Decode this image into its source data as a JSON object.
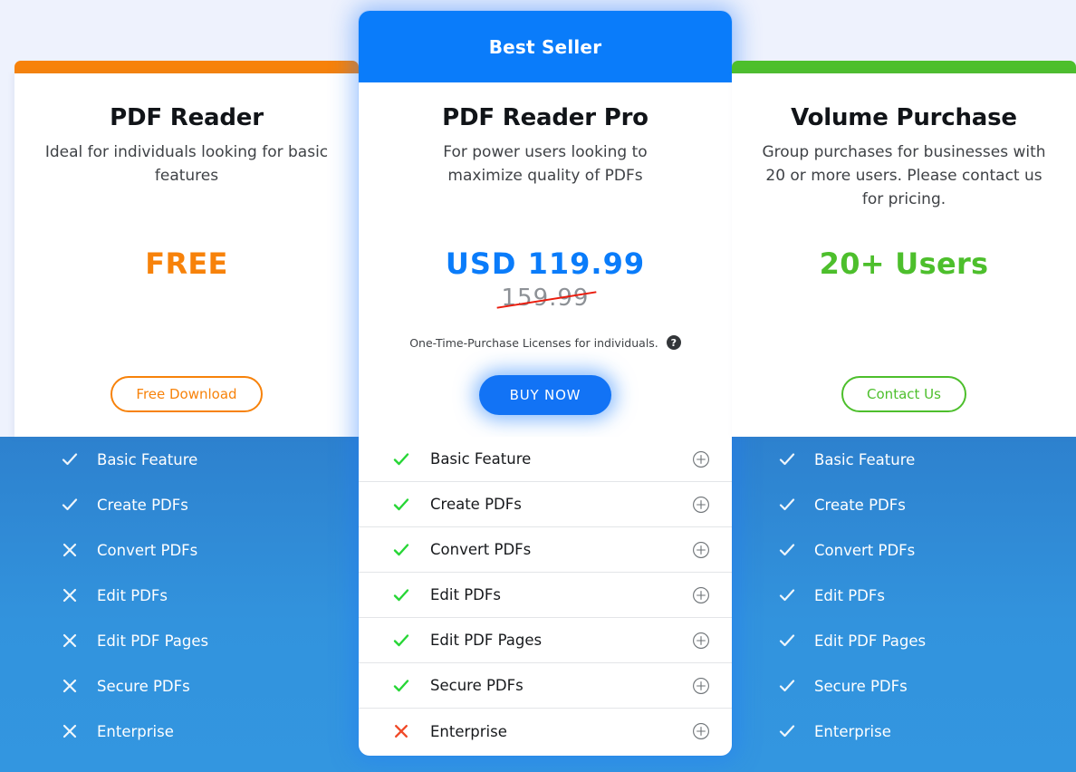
{
  "theme": {
    "page_bg": "#eef2fd",
    "panel_blue": "#3293dd",
    "accent_orange": "#f7820a",
    "accent_blue": "#0a7cfa",
    "accent_green": "#4dbf2c",
    "check_green": "#27d636",
    "cross_red": "#f04a28",
    "strike_red": "#ea1c0d"
  },
  "plans": [
    {
      "id": "pdf-reader",
      "badge": null,
      "title": "PDF Reader",
      "description": "Ideal for individuals looking for basic features",
      "price": "FREE",
      "old_price": null,
      "note": null,
      "cta_label": "Free Download",
      "features": [
        {
          "label": "Basic Feature",
          "mark": "check"
        },
        {
          "label": "Create PDFs",
          "mark": "check"
        },
        {
          "label": "Convert PDFs",
          "mark": "cross"
        },
        {
          "label": "Edit PDFs",
          "mark": "cross"
        },
        {
          "label": "Edit PDF Pages",
          "mark": "cross"
        },
        {
          "label": "Secure PDFs",
          "mark": "cross"
        },
        {
          "label": "Enterprise",
          "mark": "cross"
        }
      ]
    },
    {
      "id": "pdf-reader-pro",
      "badge": "Best Seller",
      "title": "PDF Reader Pro",
      "description": "For power users looking to maximize quality of PDFs",
      "price": "USD 119.99",
      "old_price": "159.99",
      "note": "One-Time-Purchase Licenses for individuals.",
      "note_icon": "help-icon",
      "cta_label": "BUY NOW",
      "features": [
        {
          "label": "Basic Feature",
          "mark": "check",
          "expand": "plus-icon"
        },
        {
          "label": "Create PDFs",
          "mark": "check",
          "expand": "plus-icon"
        },
        {
          "label": "Convert PDFs",
          "mark": "check",
          "expand": "plus-icon"
        },
        {
          "label": "Edit PDFs",
          "mark": "check",
          "expand": "plus-icon"
        },
        {
          "label": "Edit PDF Pages",
          "mark": "check",
          "expand": "plus-icon"
        },
        {
          "label": "Secure PDFs",
          "mark": "check",
          "expand": "plus-icon"
        },
        {
          "label": "Enterprise",
          "mark": "cross",
          "expand": "plus-icon"
        }
      ]
    },
    {
      "id": "volume-purchase",
      "badge": null,
      "title": "Volume Purchase",
      "description": "Group purchases for businesses with 20 or more users. Please contact us for pricing.",
      "price": "20+ Users",
      "old_price": null,
      "note": null,
      "cta_label": "Contact Us",
      "features": [
        {
          "label": "Basic Feature",
          "mark": "check"
        },
        {
          "label": "Create PDFs",
          "mark": "check"
        },
        {
          "label": "Convert PDFs",
          "mark": "check"
        },
        {
          "label": "Edit PDFs",
          "mark": "check"
        },
        {
          "label": "Edit PDF Pages",
          "mark": "check"
        },
        {
          "label": "Secure PDFs",
          "mark": "check"
        },
        {
          "label": "Enterprise",
          "mark": "check"
        }
      ]
    }
  ]
}
